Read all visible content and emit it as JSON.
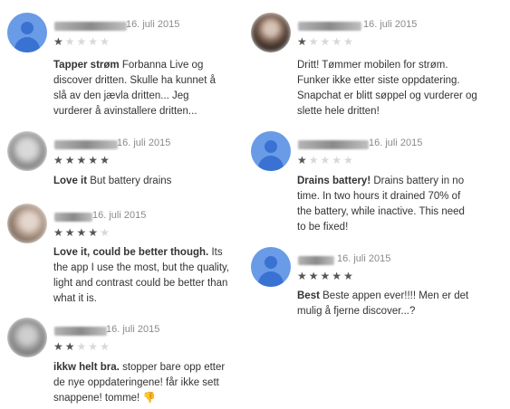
{
  "reviews": [
    {
      "date": "16. juli 2015",
      "rating": 1,
      "title": "Tapper strøm",
      "body": "Forbanna Live og discover dritten. Skulle ha kunnet å slå av den jævla dritten... Jeg vurderer å avinstallere dritten...",
      "avatar": "default-avatar"
    },
    {
      "date": "16. juli 2015",
      "rating": 5,
      "title": "Love it",
      "body": "But battery drains",
      "avatar": "photo"
    },
    {
      "date": "16. juli 2015",
      "rating": 4,
      "title": "Love it, could be better though.",
      "body": "Its the app I use the most, but the quality, light and contrast could be better than what it is.",
      "avatar": "photo"
    },
    {
      "date": "16. juli 2015",
      "rating": 2,
      "title": "ikkw helt bra.",
      "body": "stopper bare opp etter de nye oppdateringene! får ikke sett snappene! tomme! 👎",
      "avatar": "photo"
    },
    {
      "date": "16. juli 2015",
      "rating": 1,
      "title": "",
      "body": "Dritt! Tømmer mobilen for strøm. Funker ikke etter siste oppdatering. Snapchat er blitt søppel og vurderer og slette hele dritten!",
      "avatar": "photo"
    },
    {
      "date": "16. juli 2015",
      "rating": 1,
      "title": "Drains battery!",
      "body": "Drains battery in no time. In two hours it drained 70% of the battery, while inactive. This need to be fixed!",
      "avatar": "default-avatar"
    },
    {
      "date": "16. juli 2015",
      "rating": 5,
      "title": "Best",
      "body": "Beste appen ever!!!! Men er det mulig å fjerne discover...?",
      "avatar": "default-avatar"
    }
  ],
  "colors": {
    "avatar_bg": "#6a9be6",
    "avatar_fg": "#3a72d3",
    "star_on": "#555555",
    "star_off": "#d8d8d8",
    "date": "#8a8a8a"
  }
}
